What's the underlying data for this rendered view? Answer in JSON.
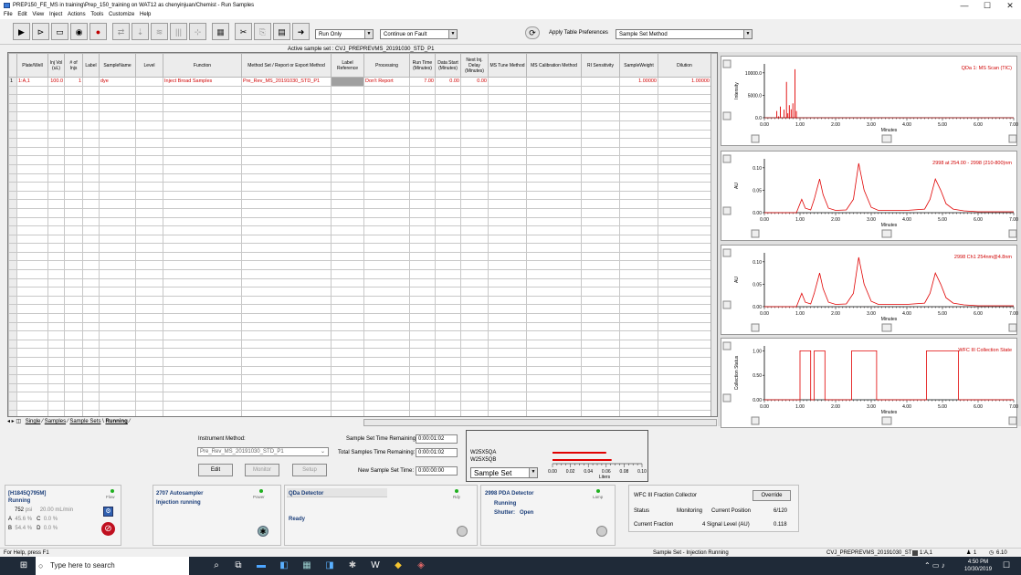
{
  "window": {
    "title": "PREP150_FE_MS in training\\Prep_150_training on WAT12 as chenyinjuan/Chemist - Run Samples",
    "minimize": "—",
    "maximize": "☐",
    "close": "✕"
  },
  "menu": [
    "File",
    "Edit",
    "View",
    "Inject",
    "Actions",
    "Tools",
    "Customize",
    "Help"
  ],
  "toolbar": {
    "run_mode": "Run Only",
    "fault_mode": "Continue on Fault",
    "apply_prefs_label": "Apply Table Preferences",
    "prefs_value": "Sample Set Method"
  },
  "grid": {
    "active_set": "Active sample set : CVJ_PREPREVMS_20191030_STD_P1",
    "headers": [
      "",
      "Plate/Well",
      "Inj Vol (uL)",
      "# of Injs",
      "Label",
      "SampleName",
      "Level",
      "Function",
      "Method Set / Report or Export Method",
      "Label Reference",
      "Processing",
      "Run Time (Minutes)",
      "Data Start (Minutes)",
      "Next Inj. Delay (Minutes)",
      "MS Tune Method",
      "MS Calibration Method",
      "RI Sensitivity",
      "SampleWeight",
      "Dilution"
    ],
    "row": [
      "1",
      "1:A,1",
      "100.0",
      "1",
      "",
      "dye",
      "",
      "Inject Broad Samples",
      "Pre_Rev_MS_20191030_STD_P1",
      "",
      "Don't Report",
      "7.00",
      "0.00",
      "0.00",
      "",
      "",
      "",
      "1.00000",
      "1.00000"
    ]
  },
  "tabs": [
    "Single",
    "Samples",
    "Sample Sets",
    "Running"
  ],
  "method_panel": {
    "instrument_method_label": "Instrument Method:",
    "instrument_method": "Pre_Rev_MS_20191030_STD_P1",
    "edit": "Edit",
    "monitor": "Monitor",
    "setup": "Setup",
    "set_remaining_label": "Sample Set Time Remaining:",
    "set_remaining": "0:00:01:02",
    "total_remaining_label": "Total Samples Time Remaining:",
    "total_remaining": "0:00:01:02",
    "new_set_label": "New Sample Set Time:",
    "new_set": "0:00:00:00"
  },
  "waste_panel": {
    "row1": "W25X5QA",
    "row2": "W25X5QB",
    "select": "Sample Set",
    "axis_ticks": [
      "0.00",
      "0.02",
      "0.04",
      "0.06",
      "0.08",
      "0.10"
    ],
    "axis_label": "Liters",
    "bar_values": [
      0.06,
      0.066
    ]
  },
  "instruments": {
    "pump": {
      "name": "[H1845Q795M]",
      "state": "Running",
      "light": "Flow",
      "psi": "752",
      "psi_unit": "psi",
      "flow": "20.00",
      "flow_unit": "mL/min",
      "a_label": "A",
      "a_val": "45.6",
      "c_label": "C",
      "c_val": "0.0",
      "b_label": "B",
      "b_val": "54.4",
      "d_label": "D",
      "d_val": "0.0",
      "pct": "%"
    },
    "autosampler": {
      "name": "2707 Autosampler",
      "light": "Power",
      "state": "Injection running"
    },
    "qda": {
      "name": "QDa Detector",
      "light": "Rdy",
      "state": "Ready"
    },
    "pda": {
      "name": "2998 PDA Detector",
      "light": "Lamp",
      "state": "Running",
      "shutter_label": "Shutter:",
      "shutter": "Open"
    },
    "wfc": {
      "name": "WFC III Fraction Collector",
      "override": "Override",
      "status_label": "Status",
      "status": "Monitoring",
      "pos_label": "Current Position",
      "pos": "6/120",
      "frac_label": "Current Fraction",
      "signal_label": "4 Signal Level (AU)",
      "signal": "0.118"
    }
  },
  "plots": [
    {
      "title": "QDa 1: MS Scan (TIC)",
      "ylabel": "Intensity",
      "yticks": [
        "10000.0",
        "5000.0",
        "0.0"
      ],
      "xlabel": "Minutes"
    },
    {
      "title": "2998 at 254.00 - 2998 (210-800)nm",
      "ylabel": "AU",
      "yticks": [
        "0.10",
        "0.05",
        "0.00"
      ],
      "xlabel": "Minutes"
    },
    {
      "title": "2998 Ch1 254nm@4.8nm",
      "ylabel": "AU",
      "yticks": [
        "0.10",
        "0.05",
        "0.00"
      ],
      "xlabel": "Minutes"
    },
    {
      "title": "WFC III Collection State",
      "ylabel": "Collection Status",
      "yticks": [
        "1.00",
        "0.50",
        "0.00"
      ],
      "xlabel": "Minutes"
    }
  ],
  "xticks": [
    "0.00",
    "1.00",
    "2.00",
    "3.00",
    "4.00",
    "5.00",
    "6.00",
    "7.00"
  ],
  "chart_data": [
    {
      "type": "line",
      "title": "QDa 1: MS Scan (TIC)",
      "ylabel": "Intensity",
      "xlabel": "Minutes",
      "xlim": [
        0,
        7
      ],
      "ylim": [
        0,
        12000
      ],
      "x": [
        0.0,
        0.3,
        0.35,
        0.4,
        0.45,
        0.5,
        0.55,
        0.6,
        0.62,
        0.66,
        0.7,
        0.72,
        0.75,
        0.78,
        0.8,
        0.84,
        0.86,
        0.88,
        0.9,
        0.95,
        1.0,
        1.5,
        2.0,
        3.0,
        4.0,
        5.0,
        6.0,
        7.0
      ],
      "y": [
        0,
        0,
        1500,
        300,
        2500,
        0,
        1800,
        0,
        8000,
        1000,
        2800,
        0,
        1900,
        0,
        3200,
        0,
        10800,
        0,
        1500,
        0,
        0,
        0,
        0,
        0,
        0,
        0,
        0,
        0
      ]
    },
    {
      "type": "line",
      "title": "2998 at 254.00 - 2998 (210-800)nm",
      "ylabel": "AU",
      "xlabel": "Minutes",
      "xlim": [
        0,
        7
      ],
      "ylim": [
        0,
        0.12
      ],
      "x": [
        0.0,
        0.9,
        1.05,
        1.15,
        1.3,
        1.4,
        1.55,
        1.65,
        1.8,
        2.0,
        2.3,
        2.5,
        2.65,
        2.8,
        3.0,
        3.2,
        4.0,
        4.5,
        4.65,
        4.8,
        4.95,
        5.1,
        5.3,
        5.6,
        6.0,
        7.0
      ],
      "y": [
        0,
        0,
        0.03,
        0.01,
        0.006,
        0.03,
        0.075,
        0.04,
        0.01,
        0.005,
        0.006,
        0.03,
        0.11,
        0.05,
        0.012,
        0.005,
        0.005,
        0.008,
        0.03,
        0.075,
        0.05,
        0.02,
        0.008,
        0.004,
        0.002,
        0.002
      ]
    },
    {
      "type": "line",
      "title": "2998 Ch1 254nm@4.8nm",
      "ylabel": "AU",
      "xlabel": "Minutes",
      "xlim": [
        0,
        7
      ],
      "ylim": [
        0,
        0.12
      ],
      "x": [
        0.0,
        0.9,
        1.05,
        1.15,
        1.3,
        1.4,
        1.55,
        1.65,
        1.8,
        2.0,
        2.3,
        2.5,
        2.65,
        2.8,
        3.0,
        3.2,
        4.0,
        4.5,
        4.65,
        4.8,
        4.95,
        5.1,
        5.3,
        5.6,
        6.0,
        7.0
      ],
      "y": [
        0,
        0,
        0.03,
        0.01,
        0.006,
        0.03,
        0.075,
        0.04,
        0.01,
        0.005,
        0.006,
        0.03,
        0.11,
        0.05,
        0.012,
        0.005,
        0.005,
        0.008,
        0.03,
        0.075,
        0.05,
        0.02,
        0.008,
        0.004,
        0.002,
        0.002
      ]
    },
    {
      "type": "line",
      "title": "WFC III Collection State",
      "ylabel": "Collection Status",
      "xlabel": "Minutes",
      "xlim": [
        0,
        7
      ],
      "ylim": [
        0,
        1.1
      ],
      "x": [
        0.0,
        1.0,
        1.0,
        1.3,
        1.3,
        1.4,
        1.4,
        1.7,
        1.7,
        2.45,
        2.45,
        3.15,
        3.15,
        4.55,
        4.55,
        5.45,
        5.45,
        7.0
      ],
      "y": [
        0,
        0,
        1,
        1,
        0,
        0,
        1,
        1,
        0,
        0,
        1,
        1,
        0,
        0,
        1,
        1,
        0,
        0
      ]
    }
  ],
  "status": {
    "left": "For Help, press F1",
    "mid": "Sample Set - Injection Running",
    "set": "CVJ_PREPREVMS_20191030_ST",
    "well": "1:A,1",
    "count": "1",
    "time": "6.10"
  },
  "taskbar": {
    "search": "Type here to search",
    "clock": "4:50 PM",
    "date": "10/30/2019"
  }
}
